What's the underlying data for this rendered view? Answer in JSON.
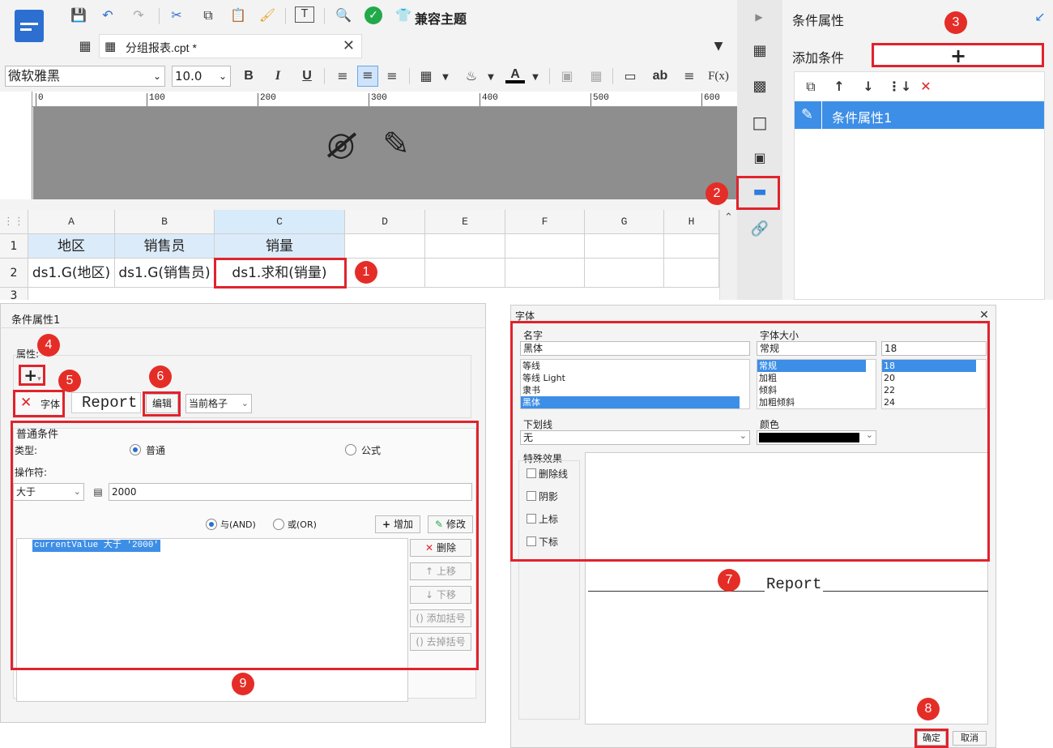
{
  "toolbar": {
    "theme_label": "兼容主题",
    "tab_file": "分组报表.cpt *",
    "font_name": "微软雅黑",
    "font_size": "10.0",
    "bold": "B",
    "italic": "I",
    "underline": "U",
    "abbr_btn": "ab",
    "fx_btn": "F(x)"
  },
  "ruler": {
    "ticks": [
      "0",
      "100",
      "200",
      "300",
      "400",
      "500",
      "600"
    ]
  },
  "sheet": {
    "columns": [
      "A",
      "B",
      "C",
      "D",
      "E",
      "F",
      "G",
      "H"
    ],
    "rows": [
      "1",
      "2",
      "3"
    ],
    "row1": [
      "地区",
      "销售员",
      "销量"
    ],
    "row2": [
      "ds1.G(地区)",
      "ds1.G(销售员)",
      "ds1.求和(销量)"
    ]
  },
  "right_panel": {
    "title": "条件属性",
    "add_condition_label": "添加条件",
    "add_plus": "+",
    "list_item": "条件属性1"
  },
  "cond_dialog": {
    "title": "条件属性1",
    "attr_label": "属性:",
    "font_attr": "字体",
    "preview_text": "Report",
    "edit_btn": "编辑",
    "scope_value": "当前格子",
    "section_title": "普通条件",
    "type_label": "类型:",
    "type_normal": "普通",
    "type_formula": "公式",
    "operator_label": "操作符:",
    "operator_value": "大于",
    "operand_value": "2000",
    "and_label": "与(AND)",
    "or_label": "或(OR)",
    "add_btn": "增加",
    "modify_btn": "修改",
    "condition_expr": "currentValue 大于 '2000'",
    "delete_btn": "删除",
    "move_up_btn": "上移",
    "move_down_btn": "下移",
    "add_paren_btn": "添加括号",
    "remove_paren_btn": "去掉括号"
  },
  "font_dialog": {
    "title": "字体",
    "name_label": "名字",
    "name_value": "黑体",
    "name_options": [
      "等线",
      "等线 Light",
      "隶书",
      "黑体"
    ],
    "size_label": "字体大小",
    "style_value": "常规",
    "style_options": [
      "常规",
      "加粗",
      "倾斜",
      "加粗倾斜"
    ],
    "size_value": "18",
    "size_options": [
      "18",
      "20",
      "22",
      "24"
    ],
    "underline_label": "下划线",
    "underline_value": "无",
    "color_label": "颜色",
    "effects_label": "特殊效果",
    "effects": [
      "删除线",
      "阴影",
      "上标",
      "下标"
    ],
    "preview_text": "Report",
    "ok_btn": "确定",
    "cancel_btn": "取消"
  },
  "badges": [
    "1",
    "2",
    "3",
    "4",
    "5",
    "6",
    "7",
    "8",
    "9"
  ],
  "colors": {
    "accent": "#3d8ee6",
    "annotation": "#e0232c"
  }
}
